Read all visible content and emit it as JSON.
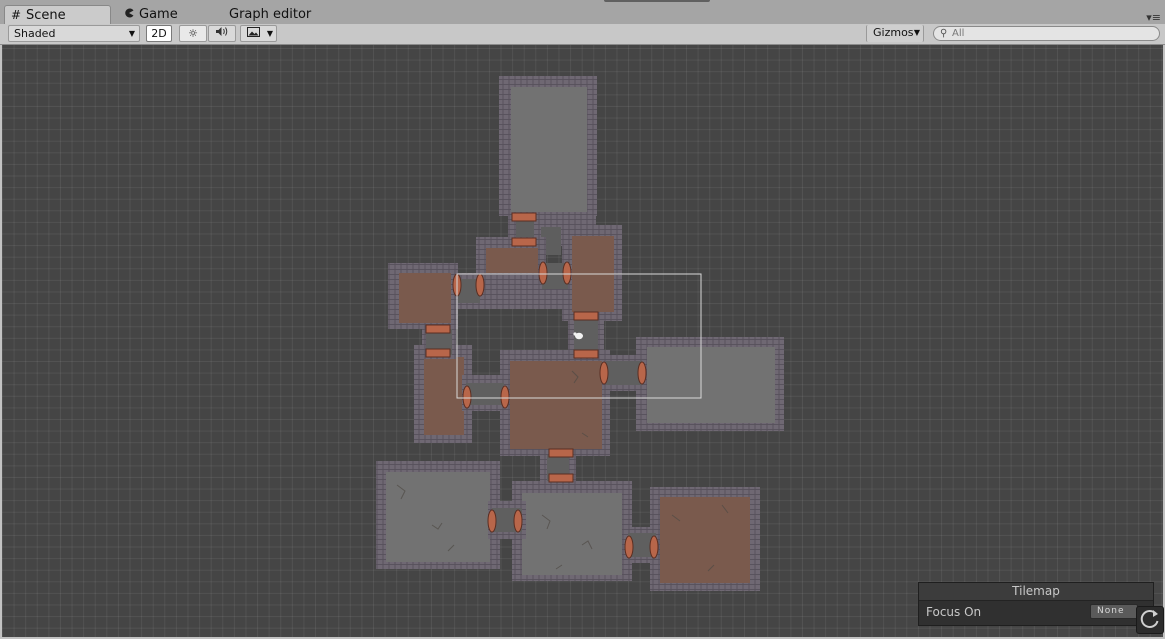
{
  "tabs": [
    {
      "label": "Scene",
      "icon": "grid-icon"
    },
    {
      "label": "Game",
      "icon": "pacman-icon"
    },
    {
      "label": "Graph editor"
    }
  ],
  "toolbar": {
    "shading_mode": "Shaded",
    "mode_2d": "2D",
    "lighting_icon": "sun-icon",
    "audio_icon": "speaker-icon",
    "effects_icon": "image-icon",
    "gizmos_label": "Gizmos",
    "search_placeholder": "All"
  },
  "tilemap_overlay": {
    "title": "Tilemap",
    "focus_label": "Focus On",
    "focus_value": "None"
  },
  "colors": {
    "viewport_bg": "#454545",
    "wall": "#6b6470",
    "floor_brown": "#7a5a4d",
    "floor_gray": "#727272",
    "door_orange": "#b8664a",
    "selection_outline": "#d9d9d9"
  }
}
